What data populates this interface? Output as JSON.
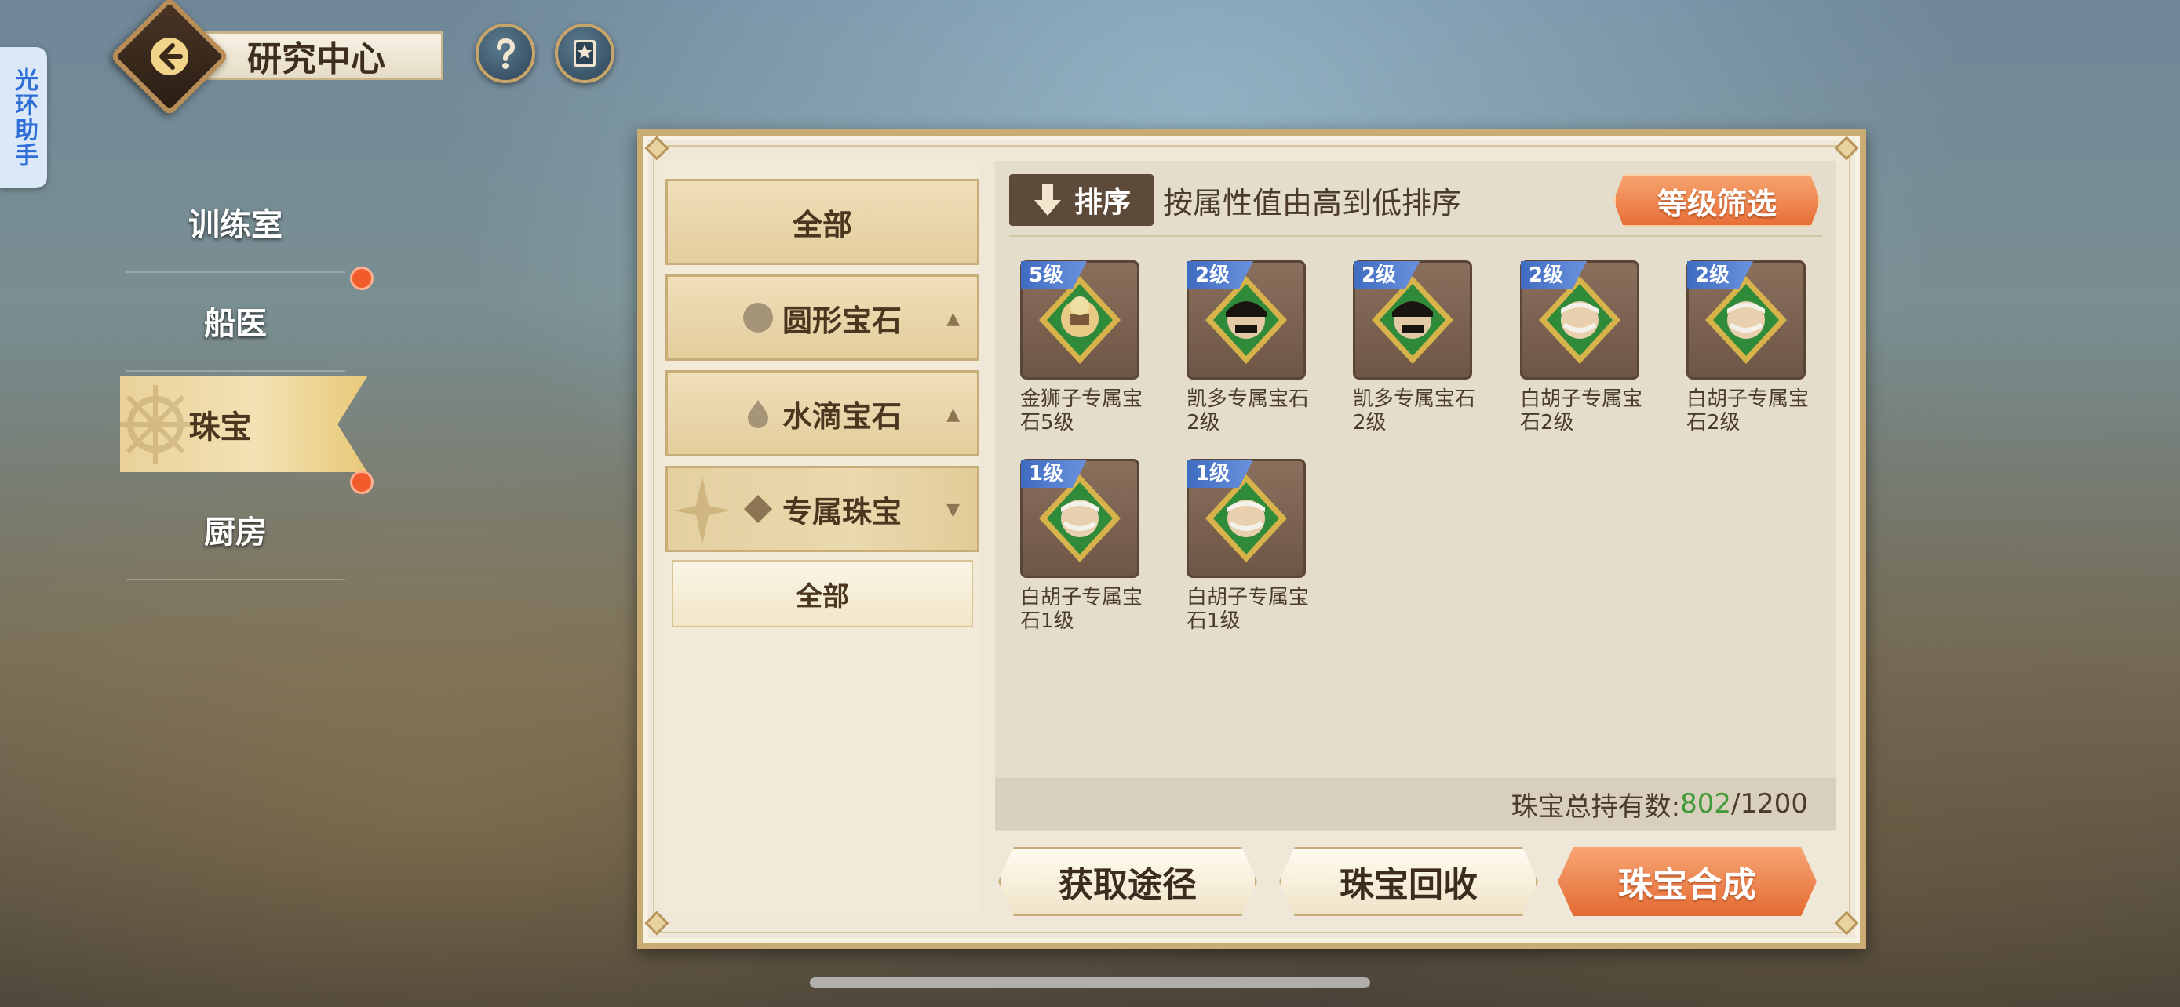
{
  "helper_tab": {
    "label": "光环助手"
  },
  "header": {
    "title": "研究中心"
  },
  "nav": {
    "items": [
      {
        "label": "训练室"
      },
      {
        "label": "船医"
      },
      {
        "label": "珠宝"
      },
      {
        "label": "厨房"
      }
    ]
  },
  "categories": {
    "all": "全部",
    "round": "圆形宝石",
    "drop": "水滴宝石",
    "exclusive": "专属珠宝",
    "sub_all": "全部"
  },
  "toolbar": {
    "sort_label": "排序",
    "sort_desc": "按属性值由高到低排序",
    "level_filter": "等级筛选"
  },
  "items": [
    {
      "level": "5级",
      "name": "金狮子专属宝石5级",
      "portrait": "golden-lion-portrait"
    },
    {
      "level": "2级",
      "name": "凯多专属宝石2级",
      "portrait": "kaido-portrait"
    },
    {
      "level": "2级",
      "name": "凯多专属宝石2级",
      "portrait": "kaido-portrait"
    },
    {
      "level": "2级",
      "name": "白胡子专属宝石2级",
      "portrait": "whitebeard-portrait"
    },
    {
      "level": "2级",
      "name": "白胡子专属宝石2级",
      "portrait": "whitebeard-portrait"
    },
    {
      "level": "1级",
      "name": "白胡子专属宝石1级",
      "portrait": "whitebeard-portrait"
    },
    {
      "level": "1级",
      "name": "白胡子专属宝石1级",
      "portrait": "whitebeard-portrait"
    }
  ],
  "count": {
    "label": "珠宝总持有数:",
    "current": "802",
    "max": "/1200"
  },
  "footer": {
    "obtain": "获取途径",
    "recycle": "珠宝回收",
    "compose": "珠宝合成"
  },
  "colors": {
    "accent_orange": "#e86f38",
    "level_badge_blue": "#3f6bc0",
    "count_green": "#3f9a3a",
    "nav_active": "#f3e2b4"
  }
}
